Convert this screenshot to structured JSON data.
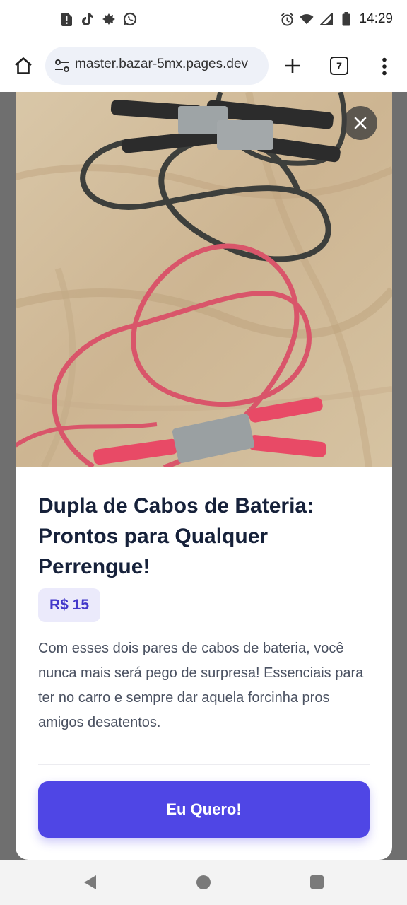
{
  "status_bar": {
    "time": "14:29",
    "left_icons": [
      "notification-icon",
      "tiktok-icon",
      "app-icon",
      "whatsapp-icon"
    ],
    "right_icons": [
      "alarm-icon",
      "wifi-icon",
      "signal-icon",
      "battery-icon"
    ]
  },
  "browser": {
    "url": "master.bazar-5mx.pages.dev",
    "tab_count": "7",
    "icons": [
      "home-icon",
      "site-settings-icon",
      "new-tab-icon",
      "tabs-icon",
      "more-icon"
    ]
  },
  "product": {
    "image_alt": "Dois pares de cabos de bateria sobre um tecido",
    "title": "Dupla de Cabos de Bateria: Prontos para Qualquer Perrengue!",
    "price": "R$ 15",
    "description": "Com esses dois pares de cabos de bateria, você nunca mais será pego de surpresa! Essenciais para ter no carro e sempre dar aquela forcinha pros amigos desatentos.",
    "cta_label": "Eu Quero!"
  },
  "colors": {
    "accent": "#4f46e5",
    "price_bg": "#ebeafb",
    "price_text": "#4338ca",
    "title": "#16213a",
    "body_text": "#4b5262"
  },
  "navbar": {
    "icons": [
      "back-icon",
      "home-nav-icon",
      "recent-apps-icon"
    ]
  }
}
